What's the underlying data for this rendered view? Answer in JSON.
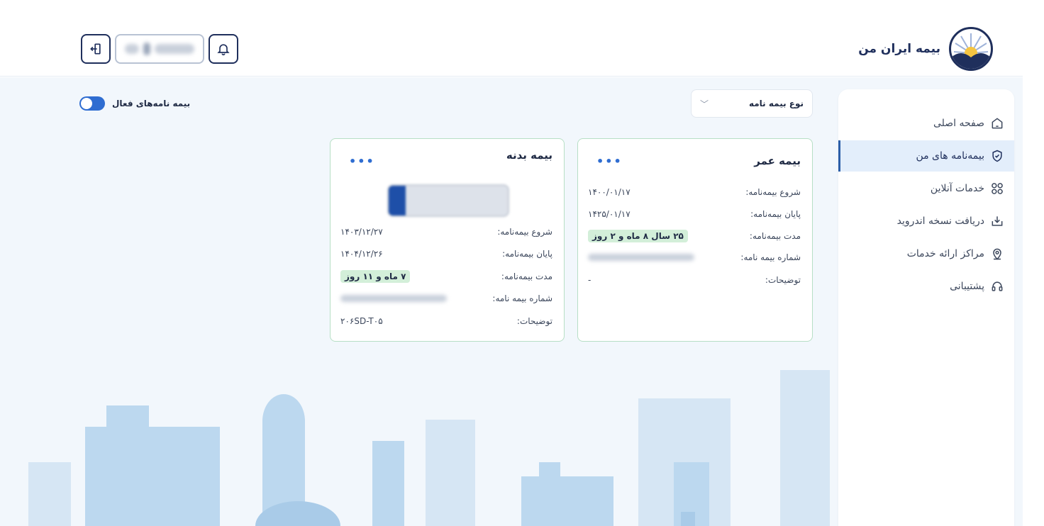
{
  "brand": {
    "name": "بیمه ایران من"
  },
  "header": {
    "bell_icon": "bell-icon",
    "exit_icon": "exit-icon",
    "user_name": ""
  },
  "sidebar": {
    "items": [
      {
        "label": "صفحه اصلی",
        "icon": "home-icon",
        "active": false
      },
      {
        "label": "بیمه‌نامه های من",
        "icon": "shield-check-icon",
        "active": true
      },
      {
        "label": "خدمات آنلاین",
        "icon": "grid-icon",
        "active": false
      },
      {
        "label": "دریافت نسخه اندروید",
        "icon": "download-icon",
        "active": false
      },
      {
        "label": "مراکز ارائه خدمات",
        "icon": "location-icon",
        "active": false
      },
      {
        "label": "پشتیبانی",
        "icon": "headset-icon",
        "active": false
      }
    ]
  },
  "filter": {
    "label": "نوع بیمه نامه"
  },
  "active_toggle": {
    "label": "بیمه نامه‌های فعال",
    "on": true
  },
  "cards": {
    "omr": {
      "title": "بیمه عمر",
      "rows": [
        {
          "label": "شروع بیمه‌نامه:",
          "value": "۱۴۰۰/۰۱/۱۷"
        },
        {
          "label": "پایان بیمه‌نامه:",
          "value": "۱۴۲۵/۰۱/۱۷"
        },
        {
          "label": "مدت بیمه‌نامه:",
          "value": "۲۵ سال ۸ ماه و ۲ روز"
        },
        {
          "label": "شماره بیمه نامه:",
          "value": ""
        },
        {
          "label": "توضیحات:",
          "value": "-"
        }
      ]
    },
    "badane": {
      "title": "بیمه بدنه",
      "rows": [
        {
          "label": "شروع بیمه‌نامه:",
          "value": "۱۴۰۳/۱۲/۲۷"
        },
        {
          "label": "پایان بیمه‌نامه:",
          "value": "۱۴۰۴/۱۲/۲۶"
        },
        {
          "label": "مدت بیمه‌نامه:",
          "value": "۷ ماه و ۱۱ روز"
        },
        {
          "label": "شماره بیمه نامه:",
          "value": ""
        },
        {
          "label": "توضیحات:",
          "value": "۲۰۶SD-T۰۵"
        }
      ]
    }
  },
  "colors": {
    "accent": "#2f6dd1",
    "navy": "#1f2f5c",
    "card_border": "#b7dfc5",
    "badge_bg": "#d3efd9",
    "page_bg": "#f2f7fc"
  }
}
